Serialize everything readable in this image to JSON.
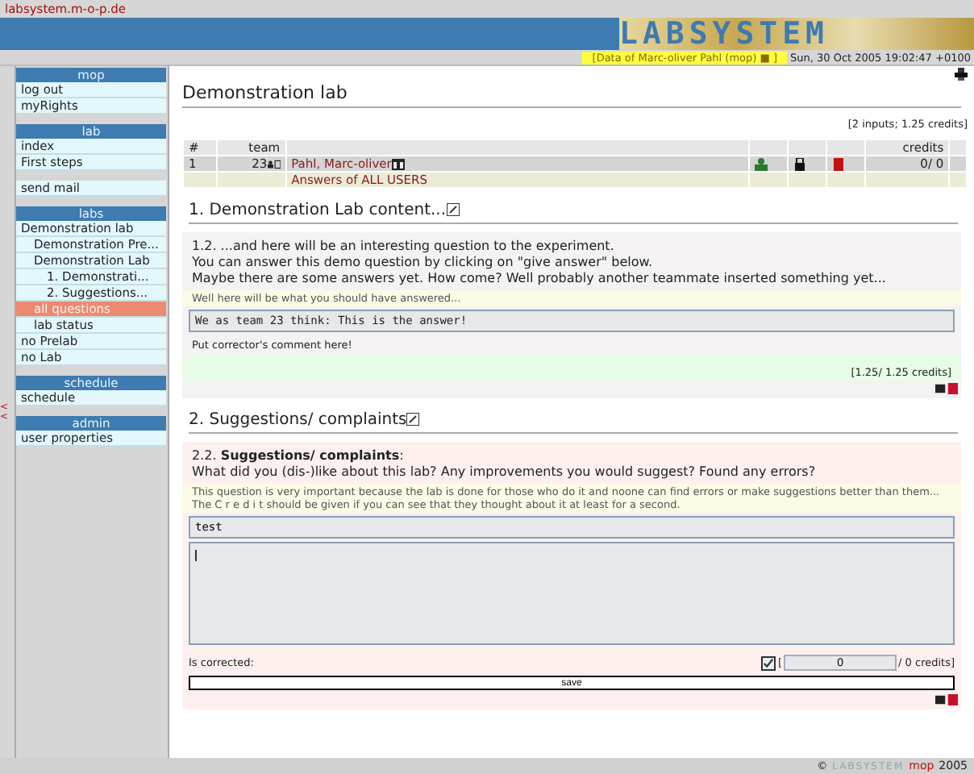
{
  "address_bar": {
    "url": "labsystem.m-o-p.de"
  },
  "banner": {
    "logo": "LABSYSTEM"
  },
  "info_bar": {
    "user": "[Data of Marc-oliver Pahl (mop) ■ ]",
    "date": "Sun, 30 Oct 2005 19:02:47 +0100"
  },
  "sidebar": {
    "collapse": "< <",
    "sections": [
      {
        "title": "mop",
        "groups": [
          [
            {
              "label": "log out",
              "selected": false
            },
            {
              "label": "myRights",
              "selected": false
            }
          ]
        ]
      },
      {
        "title": "lab",
        "groups": [
          [
            {
              "label": "index",
              "selected": false
            },
            {
              "label": "First steps",
              "selected": false
            }
          ],
          [
            {
              "label": "send mail",
              "selected": false
            }
          ]
        ]
      },
      {
        "title": "labs",
        "groups": [
          [
            {
              "label": "Demonstration lab",
              "selected": false,
              "children": [
                {
                  "label": "Demonstration Pre...",
                  "selected": false
                },
                {
                  "label": "Demonstration Lab",
                  "selected": false,
                  "children": [
                    {
                      "label": "1. Demonstrati...",
                      "selected": false
                    },
                    {
                      "label": "2. Suggestions...",
                      "selected": false
                    }
                  ]
                },
                {
                  "label": "all questions",
                  "selected": true
                },
                {
                  "label": "lab status",
                  "selected": false
                }
              ]
            },
            {
              "label": "no Prelab",
              "selected": false
            },
            {
              "label": "no Lab",
              "selected": false
            }
          ]
        ]
      },
      {
        "title": "schedule",
        "groups": [
          [
            {
              "label": "schedule",
              "selected": false
            }
          ]
        ]
      },
      {
        "title": "admin",
        "groups": [
          [
            {
              "label": "user properties",
              "selected": false
            }
          ]
        ]
      }
    ]
  },
  "page": {
    "title": "Demonstration lab",
    "summary": "[2 inputs; 1.25 credits]",
    "table": {
      "columns": [
        "#",
        "team",
        "credits"
      ],
      "rows": [
        {
          "number": "1",
          "team": "23",
          "name": "Pahl, Marc-oliver",
          "credits": "0/ 0",
          "link": "Answers of ALL USERS"
        }
      ]
    },
    "sections": [
      {
        "heading": "1. Demonstration Lab content...",
        "kind": "answered",
        "question": [
          "1.2. ...and here will be an interesting question to the experiment.",
          "You can answer this demo question by clicking on \"give answer\" below.",
          "Maybe there are some answers yet. How come? Well probably another teammate inserted something yet..."
        ],
        "hint": [
          "Well here will be what you should have answered..."
        ],
        "answer": "We as team 23 think: This is the answer!",
        "comment": "Put corrector's comment here!",
        "credits": "[1.25/ 1.25 credits]"
      },
      {
        "heading": "2. Suggestions/ complaints",
        "kind": "editing",
        "question": [
          "2.2. **Suggestions/ complaints**:",
          "What did you (dis-)like about this lab? Any improvements you would suggest? Found any errors?"
        ],
        "hint": [
          "This question is very important because the lab is done for those who do it and noone can find errors or make suggestions better than them...",
          "The C r e d i t should be given if you can see that they thought about it at least for a second."
        ],
        "answer": "test",
        "corrected_label": "Is corrected:",
        "corrected": true,
        "open_bracket": "[",
        "credit_value": "0",
        "credit_suffix": "/ 0 credits]",
        "save": "save"
      }
    ]
  },
  "footer": {
    "copyright": "©",
    "logo": "LABSYSTEM",
    "owner": "mop",
    "year": "2005"
  }
}
